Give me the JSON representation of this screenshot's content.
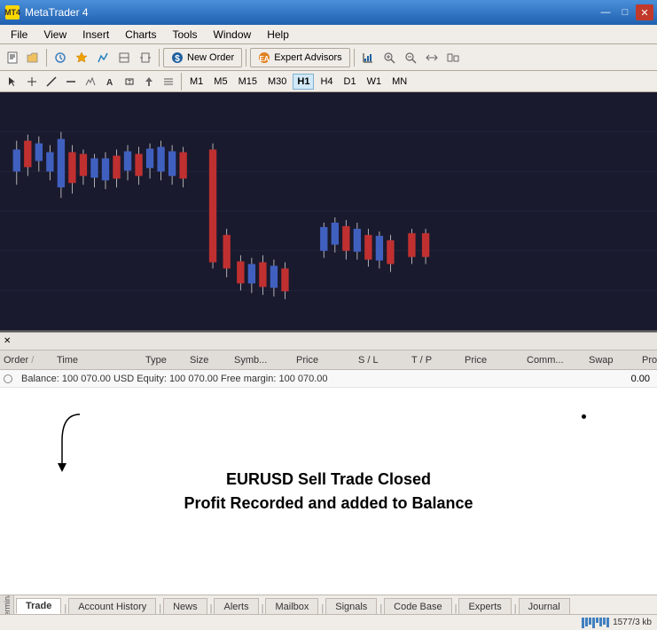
{
  "titleBar": {
    "icon": "MT",
    "title": "MetaTrader 4",
    "minBtn": "—",
    "maxBtn": "□",
    "closeBtn": "✕"
  },
  "menuBar": {
    "items": [
      "File",
      "View",
      "Insert",
      "Charts",
      "Tools",
      "Window",
      "Help"
    ]
  },
  "toolbar": {
    "newOrderLabel": "New Order",
    "expertAdvisorsLabel": "Expert Advisors"
  },
  "chartToolbar": {
    "timeframes": [
      "M1",
      "M5",
      "M15",
      "M30",
      "H1",
      "H4",
      "D1",
      "W1",
      "MN"
    ],
    "activeTimeframe": "H1"
  },
  "tableHeader": {
    "order": "Order",
    "sortIndicator": "/",
    "time": "Time",
    "type": "Type",
    "size": "Size",
    "symbol": "Symb...",
    "price": "Price",
    "sl": "S / L",
    "tp": "T / P",
    "price2": "Price",
    "comm": "Comm...",
    "swap": "Swap",
    "profit": "Profit"
  },
  "tableRow": {
    "balanceInfo": "Balance: 100 070.00 USD   Equity: 100 070.00   Free margin: 100 070.00",
    "profitValue": "0.00"
  },
  "annotation": {
    "line1": "EURUSD Sell Trade Closed",
    "line2": "Profit Recorded and added to Balance"
  },
  "bottomTabs": {
    "items": [
      "Trade",
      "Account History",
      "News",
      "Alerts",
      "Mailbox",
      "Signals",
      "Code Base",
      "Experts",
      "Journal"
    ],
    "activeTab": "Trade"
  },
  "statusBar": {
    "sideLabel": "Terminal",
    "rightInfo": "1577/3 kb",
    "barSegments": 8
  }
}
